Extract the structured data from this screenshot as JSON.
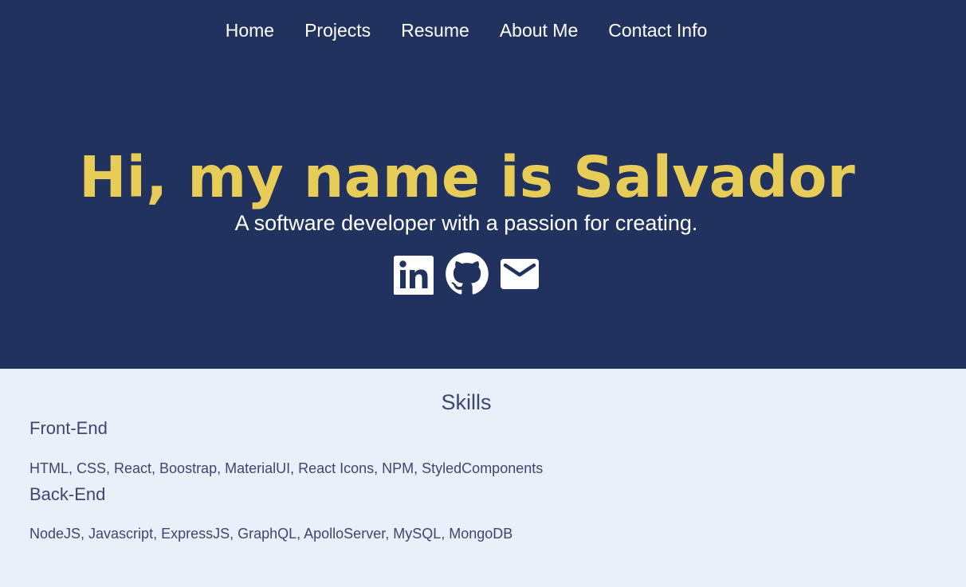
{
  "nav": {
    "items": [
      "Home",
      "Projects",
      "Resume",
      "About Me",
      "Contact Info"
    ]
  },
  "hero": {
    "title": "Hi, my name is Salvador",
    "subtitle": "A software developer with a passion for creating.",
    "social_icons": [
      "linkedin-icon",
      "github-icon",
      "email-icon"
    ]
  },
  "skills": {
    "title": "Skills",
    "categories": [
      {
        "name": "Front-End",
        "items": "HTML, CSS, React, Boostrap, MaterialUI, React Icons, NPM, StyledComponents"
      },
      {
        "name": "Back-End",
        "items": "NodeJS, Javascript, ExpressJS, GraphQL, ApolloServer, MySQL, MongoDB"
      }
    ]
  },
  "colors": {
    "hero_background": "#22325f",
    "accent_yellow": "#e8cc58",
    "skills_background": "#e9f0f9",
    "skills_text": "#3d4670"
  }
}
